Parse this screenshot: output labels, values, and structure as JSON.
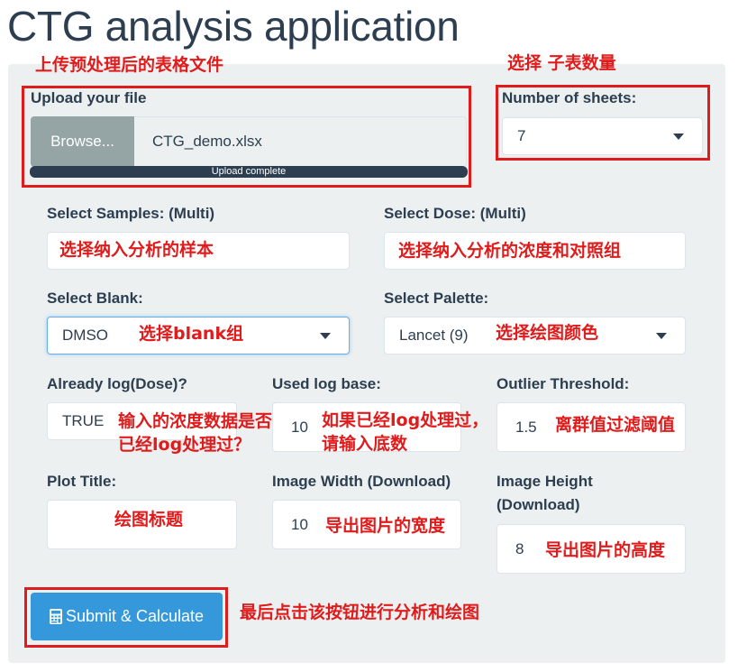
{
  "app": {
    "title": "CTG analysis application"
  },
  "upload": {
    "label": "Upload your file",
    "browse_label": "Browse...",
    "file_name": "CTG_demo.xlsx",
    "progress_text": "Upload complete",
    "progress_fraction": 1.0
  },
  "sheets": {
    "label": "Number of sheets:",
    "value": "7"
  },
  "samples": {
    "label": "Select Samples: (Multi)",
    "value": ""
  },
  "dose": {
    "label": "Select Dose: (Multi)",
    "value": ""
  },
  "blank": {
    "label": "Select Blank:",
    "value": "DMSO"
  },
  "palette": {
    "label": "Select Palette:",
    "value": "Lancet (9)"
  },
  "already_log": {
    "label": "Already log(Dose)?",
    "value": "TRUE"
  },
  "log_base": {
    "label": "Used log base:",
    "value": "10"
  },
  "outlier": {
    "label": "Outlier Threshold:",
    "value": "1.5"
  },
  "plot_title": {
    "label": "Plot Title:",
    "value": ""
  },
  "image_width": {
    "label": "Image Width (Download)",
    "value": "10"
  },
  "image_height": {
    "label": "Image Height (Download)",
    "value": "8"
  },
  "submit": {
    "label": "Submit & Calculate",
    "icon": "calculator-icon"
  },
  "annotations": {
    "upload": "上传预处理后的表格文件",
    "sheets": "选择 子表数量",
    "samples": "选择纳入分析的样本",
    "dose": "选择纳入分析的浓度和对照组",
    "blank": "选择blank组",
    "palette": "选择绘图颜色",
    "already_log_1": "输入的浓度数据是否",
    "already_log_2": "已经log处理过？",
    "log_base_1": "如果已经log处理过，",
    "log_base_2": "请输入底数",
    "outlier": "离群值过滤阈值",
    "plot_title": "绘图标题",
    "image_width": "导出图片的宽度",
    "image_height": "导出图片的高度",
    "submit": "最后点击该按钮进行分析和绘图"
  },
  "colors": {
    "annotation": "#e01b1b",
    "primary": "#3498db",
    "panel": "#ecf0f1",
    "text": "#2c3e50",
    "browse": "#95a5a6"
  }
}
